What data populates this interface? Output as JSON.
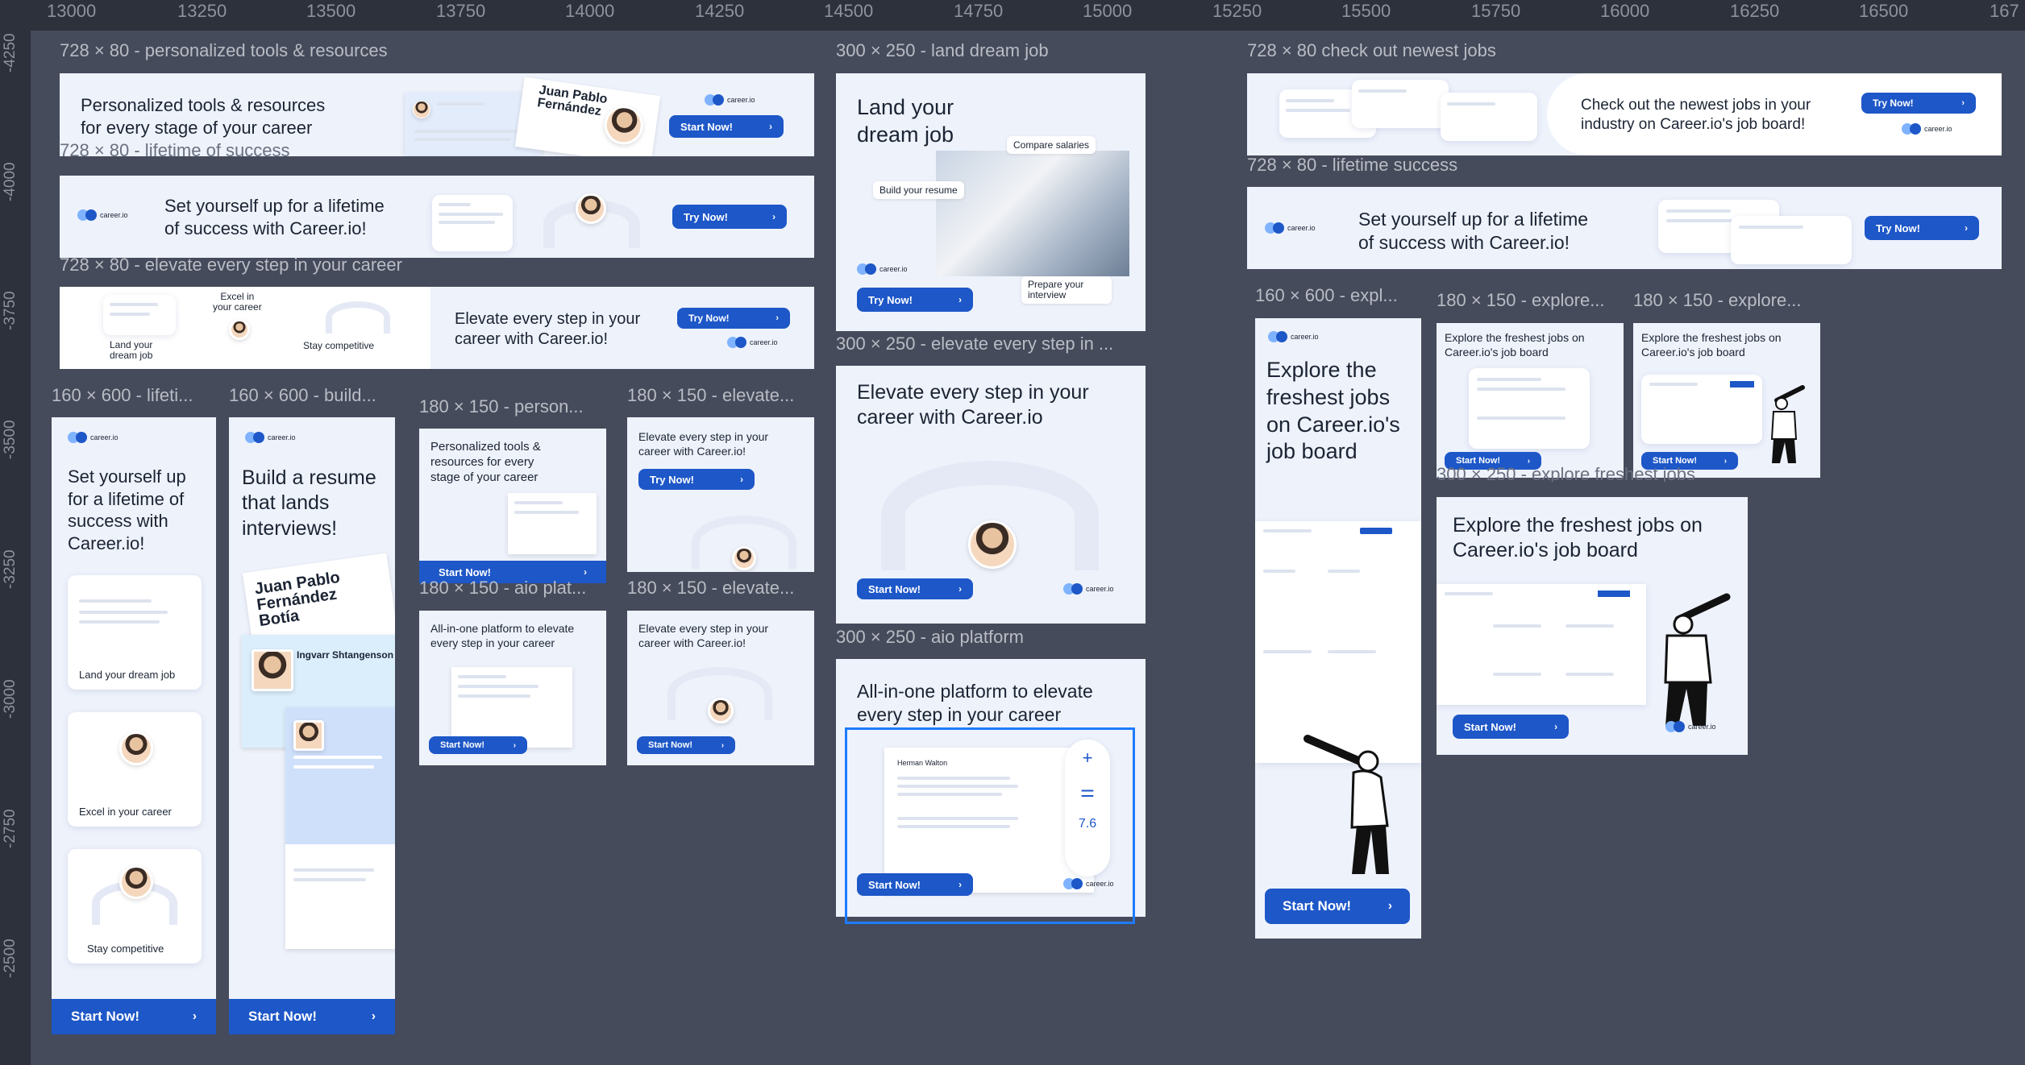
{
  "ruler": {
    "top_ticks": [
      "13000",
      "13250",
      "13500",
      "13750",
      "14000",
      "14250",
      "14500",
      "14750",
      "15000",
      "15250",
      "15500",
      "15750",
      "16000",
      "16250",
      "16500",
      "167"
    ],
    "left_ticks": [
      "-4250",
      "-4000",
      "-3750",
      "-3500",
      "-3250",
      "-3000",
      "-2750",
      "-2500"
    ]
  },
  "labels": {
    "l1": "728 × 80 - personalized tools & resources",
    "l2": "728 × 80 - lifetime of success",
    "l3": "728 × 80 - elevate every step in your career",
    "l4": "160 × 600 - lifeti...",
    "l5": "160 × 600 - build...",
    "l6": "180 × 150 - person...",
    "l7": "180 × 150 - elevate...",
    "l8": "180 × 150 - aio plat...",
    "l9": "180 × 150 - elevate...",
    "l10": "300 × 250 - land dream job",
    "l11": "300 × 250 - elevate every step in ...",
    "l12": "300 × 250 - aio platform",
    "l13": "728 × 80 check out newest jobs",
    "l14": "728 × 80 - lifetime success",
    "l15": "160 × 600 - expl...",
    "l16": "180 × 150 - explore...",
    "l17": "180 × 150 - explore...",
    "l18": "300 × 250 - explore freshest jobs"
  },
  "banners": {
    "b1_text": "Personalized tools & resources\nfor every stage of your career",
    "b1_btn": "Start Now!",
    "b1_name": "Juan Pablo\nFernández",
    "b2_text": "Set yourself up for a lifetime\nof success with Career.io!",
    "b2_btn": "Try Now!",
    "b3_text": "Elevate every step in your\ncareer with Career.io!",
    "b3_btn": "Try Now!",
    "b3_land": "Land your\ndream job",
    "b3_excel": "Excel in\nyour career",
    "b3_stay": "Stay competitive",
    "s1_text": "Set yourself up for a lifetime of success with Career.io!",
    "s1_c1": "Land your dream job",
    "s1_c2": "Excel in your career",
    "s1_c3": "Stay competitive",
    "s1_btn": "Start Now!",
    "s2_text": "Build a resume that lands interviews!",
    "s2_name": "Juan Pablo Fernández Botía",
    "s2_name2": "Ingvarr Shtangenson",
    "s2_btn": "Start Now!",
    "m1_text": "Personalized tools & resources for every stage of your career",
    "m1_btn": "Start Now!",
    "m2_text": "Elevate every step in your career with Career.io!",
    "m2_btn": "Try Now!",
    "m3_text": "All-in-one platform to elevate every step in your career",
    "m3_btn": "Start Now!",
    "m4_text": "Elevate every step in your career with Career.io!",
    "m4_btn": "Start Now!",
    "r1_text": "Land your dream job",
    "r1_b1": "Compare salaries",
    "r1_b2": "Build your resume",
    "r1_b3": "Prepare your interview",
    "r1_btn": "Try Now!",
    "r2_text": "Elevate every step in your career with Career.io",
    "r2_btn": "Start Now!",
    "r3_text": "All-in-one platform to elevate every step in your career",
    "r3_btn": "Start Now!",
    "r3_score": "7.6",
    "r3_name": "Herman Walton",
    "x1_text": "Check out the newest jobs in your industry on Career.io's job board!",
    "x1_btn": "Try Now!",
    "x2_text": "Set yourself up for a lifetime\nof success with Career.io!",
    "x2_btn": "Try Now!",
    "x3_text": "Explore the freshest jobs on Career.io's job board",
    "x3_btn": "Start Now!",
    "x4_text": "Explore the freshest jobs on Career.io's job board",
    "x4_btn": "Start Now!",
    "x5_text": "Explore the freshest jobs on Career.io's job board",
    "x5_btn": "Start Now!",
    "x6_text": "Explore the freshest jobs on Career.io's job board",
    "x6_btn": "Start Now!",
    "logo": "career.io"
  },
  "colors": {
    "accent": "#1d57c8",
    "canvas": "#454b5b",
    "frame_bg": "#eef2fb",
    "selection": "#1e7bff"
  }
}
